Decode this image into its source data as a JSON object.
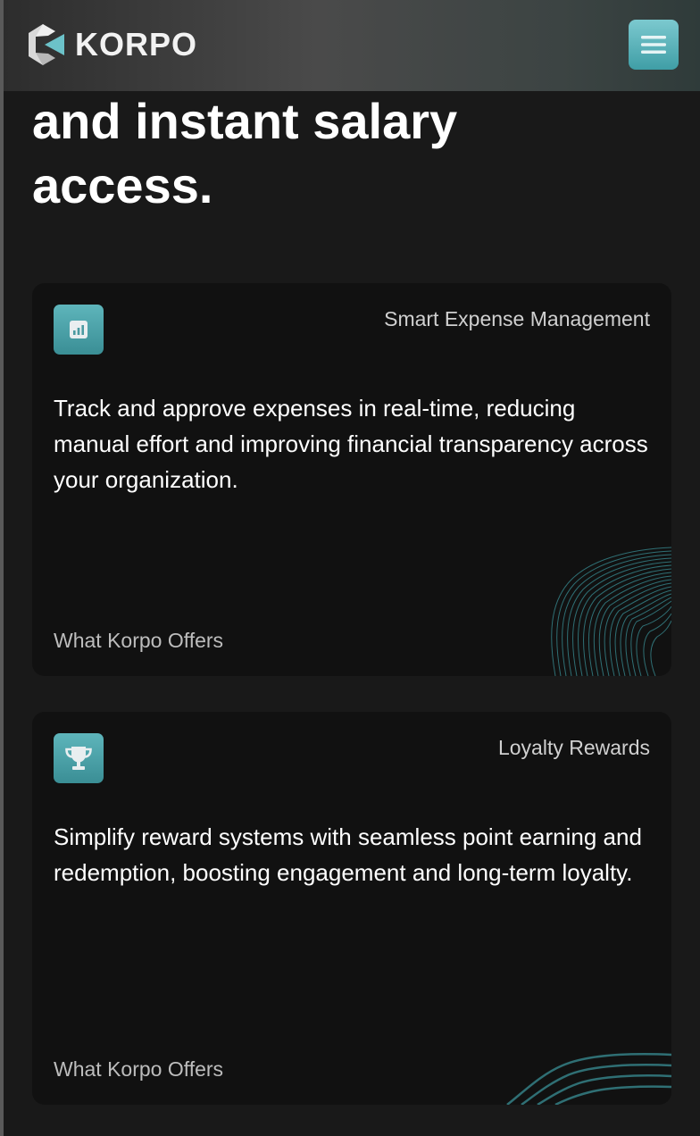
{
  "header": {
    "brand_name": "KORPO",
    "logo_icon": "korpo-logo-mark",
    "menu_icon": "hamburger-menu-icon"
  },
  "hero": {
    "heading_line1": "and instant salary",
    "heading_line2": "access."
  },
  "cards": [
    {
      "icon": "bar-chart-icon",
      "title": "Smart Expense Management",
      "description": "Track and approve expenses in real-time, reducing manual effort and improving financial transparency across your organization.",
      "footer": "What Korpo Offers"
    },
    {
      "icon": "trophy-icon",
      "title": "Loyalty Rewards",
      "description": "Simplify reward systems with seamless point earning and redemption, boosting engagement and long-term loyalty.",
      "footer": "What Korpo Offers"
    }
  ],
  "colors": {
    "page_background": "#191919",
    "card_background": "#111111",
    "accent_teal": "#4fa8ae",
    "header_gradient_start": "#2d2d2d",
    "header_gradient_end": "#2f3b3a"
  }
}
